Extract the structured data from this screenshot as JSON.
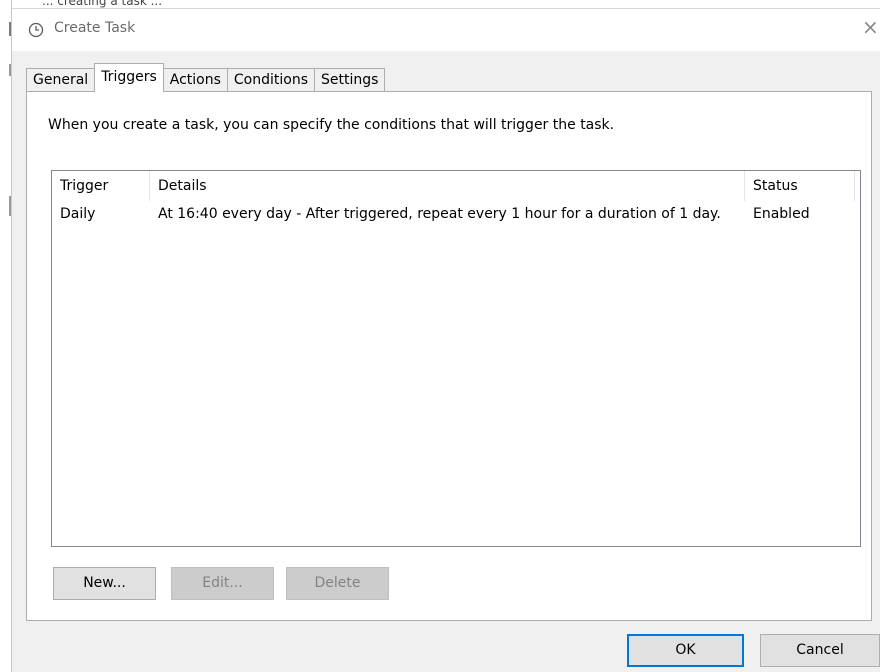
{
  "window": {
    "title": "Create Task",
    "close_glyph": "×",
    "title_icon": "clock-icon",
    "background_sliver_text": "... creating a task ..."
  },
  "tabs": [
    {
      "label": "General"
    },
    {
      "label": "Triggers",
      "active": true
    },
    {
      "label": "Actions"
    },
    {
      "label": "Conditions"
    },
    {
      "label": "Settings"
    }
  ],
  "triggers_panel": {
    "intro": "When you create a task, you can specify the conditions that will trigger the task.",
    "columns": [
      "Trigger",
      "Details",
      "Status"
    ],
    "rows": [
      {
        "trigger": "Daily",
        "details": "At 16:40 every day - After triggered, repeat every 1 hour for a duration of 1 day.",
        "status": "Enabled"
      }
    ],
    "buttons": {
      "new": "New...",
      "edit": "Edit...",
      "delete": "Delete"
    }
  },
  "footer": {
    "ok": "OK",
    "cancel": "Cancel"
  },
  "colors": {
    "dialog_bg": "#f0f0f0",
    "panel_bg": "#ffffff",
    "accent_border": "#0078d7",
    "disabled_text": "#838383"
  }
}
